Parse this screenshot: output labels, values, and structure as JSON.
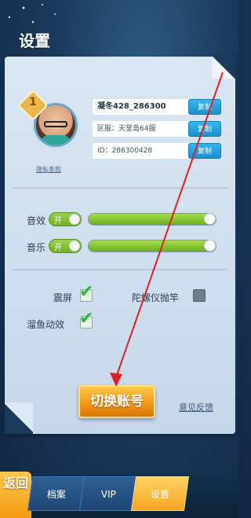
{
  "header": {
    "title": "设置"
  },
  "profile": {
    "level": "1",
    "name": "凝冬428_286300",
    "server": "区服：天堂岛64服",
    "id": "ID：286300428",
    "copy_label": "复制",
    "privacy_link": "隐私条款"
  },
  "audio": {
    "sound_effects": {
      "label": "音效",
      "toggle": "开",
      "level": 1.0
    },
    "music": {
      "label": "音乐",
      "toggle": "开",
      "level": 1.0
    }
  },
  "options": {
    "shake": {
      "label": "震屏",
      "checked": true
    },
    "gyro": {
      "label": "陀螺仪抛竿",
      "checked": false
    },
    "fish_effect": {
      "label": "溜鱼动效",
      "checked": true
    }
  },
  "actions": {
    "switch_account": "切换账号",
    "feedback": "意见反馈"
  },
  "bottom_nav": {
    "back": "返回",
    "tabs": [
      {
        "label": "档案",
        "active": false
      },
      {
        "label": "VIP",
        "active": false
      },
      {
        "label": "设置",
        "active": true
      }
    ]
  },
  "colors": {
    "accent_orange": "#f59a16",
    "copy_blue": "#1a8fcd",
    "toggle_green": "#6fae26",
    "arrow_red": "#e02020"
  }
}
